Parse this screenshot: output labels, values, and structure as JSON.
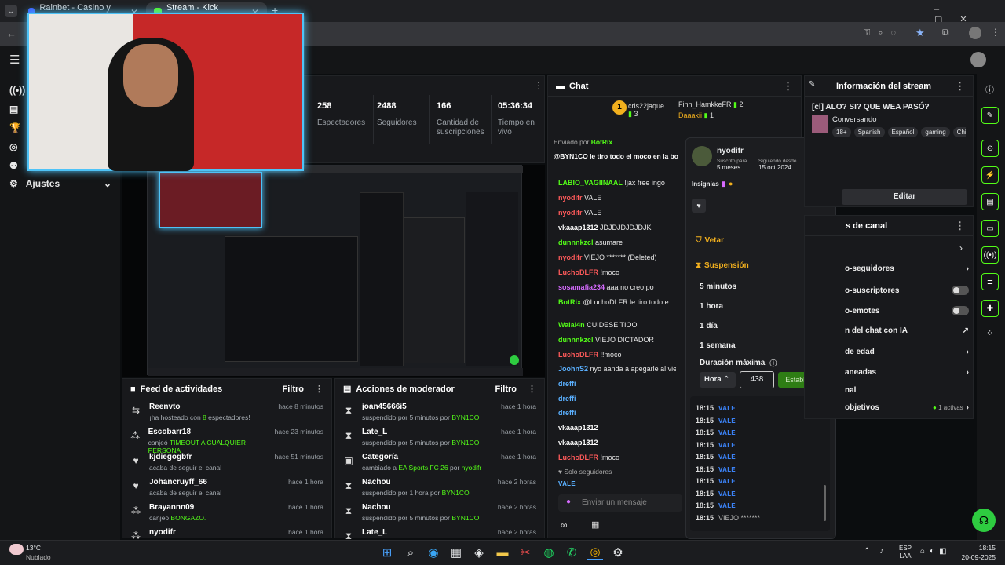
{
  "browser": {
    "tabs": [
      {
        "label": "Rainbet - Casino y Casa de Apu"
      },
      {
        "label": "Stream - Kick Dashboard"
      }
    ]
  },
  "nav": {
    "settings_label": "Ajustes"
  },
  "stats": [
    {
      "value": "258",
      "label": "Espectadores"
    },
    {
      "value": "2488",
      "label": "Seguidores"
    },
    {
      "value": "166",
      "label": "Cantidad de suscripciones"
    },
    {
      "value": "05:36:34",
      "label": "Tiempo en vivo"
    }
  ],
  "feed": {
    "title": "Feed de actividades",
    "filter": "Filtro",
    "rows": [
      {
        "name": "Reenvto",
        "time": "hace 8 minutos",
        "pre": "¡ha hosteado con ",
        "hl": "8",
        "post": " espectadores!"
      },
      {
        "name": "Escobarr18",
        "time": "hace 23 minutos",
        "pre": "canjeó ",
        "hl": "TIMEOUT A CUALQUIER PERSONA",
        "post": ""
      },
      {
        "name": "kjdiegogbfr",
        "time": "hace 51 minutos",
        "pre": "acaba de seguir el canal",
        "hl": "",
        "post": ""
      },
      {
        "name": "Johancruyff_66",
        "time": "hace 1 hora",
        "pre": "acaba de seguir el canal",
        "hl": "",
        "post": ""
      },
      {
        "name": "Brayannn09",
        "time": "hace 1 hora",
        "pre": "canjeó ",
        "hl": "BONGAZO.",
        "post": ""
      },
      {
        "name": "nyodifr",
        "time": "hace 1 hora",
        "pre": "",
        "hl": "",
        "post": ""
      }
    ]
  },
  "mod": {
    "title": "Acciones de moderador",
    "filter": "Filtro",
    "rows": [
      {
        "name": "joan45666i5",
        "time": "hace 1 hora",
        "pre": "suspendido por 5 minutos por ",
        "hl": "BYN1CO"
      },
      {
        "name": "Late_L",
        "time": "hace 1 hora",
        "pre": "suspendido por 5 minutos por ",
        "hl": "BYN1CO"
      },
      {
        "name": "Categoría",
        "time": "hace 1 hora",
        "pre": "cambiado a ",
        "hl": "EA Sports FC 26",
        "post2": " por ",
        "hl2": "nyodifr"
      },
      {
        "name": "Nachou",
        "time": "hace 2 horas",
        "pre": "suspendido por 1 hora por ",
        "hl": "BYN1CO"
      },
      {
        "name": "Nachou",
        "time": "hace 2 horas",
        "pre": "suspendido por 5 minutos por ",
        "hl": "BYN1CO"
      },
      {
        "name": "Late_L",
        "time": "hace 2 horas",
        "pre": "",
        "hl": ""
      }
    ]
  },
  "chat": {
    "title": "Chat",
    "top": [
      {
        "name": "cris22jaque",
        "count": "3"
      },
      {
        "name": "Finn_HamkkeFR",
        "count": "2"
      },
      {
        "name": "Daaakii",
        "count": "1"
      }
    ],
    "pinned_by": "Enviado por",
    "pinned_user": "BotRix",
    "pinned_msg": "@BYN1CO le tiro todo el moco en la bo",
    "lines": [
      {
        "u": "LABIO_VAGIINAAL",
        "c": "#53fc18",
        "m": " !jax free ingo"
      },
      {
        "u": "nyodifr",
        "c": "#ff5a5a",
        "m": " VALE"
      },
      {
        "u": "nyodifr",
        "c": "#ff5a5a",
        "m": " VALE"
      },
      {
        "u": "vkaaap1312",
        "c": "#ffffff",
        "m": " JDJDJDJDJDJK"
      },
      {
        "u": "dunnnkzcl",
        "c": "#53fc18",
        "m": " asumare"
      },
      {
        "u": "nyodifr",
        "c": "#ff5a5a",
        "m": " VIEJO ******* (Deleted)"
      },
      {
        "u": "LuchoDLFR",
        "c": "#ff5a5a",
        "m": " !moco"
      },
      {
        "u": "sosamafia234",
        "c": "#d66bff",
        "m": " aaa no creo po"
      },
      {
        "u": "BotRix",
        "c": "#53fc18",
        "m": " @LuchoDLFR le tiro todo e"
      },
      {
        "u": "",
        "c": "#ffffff",
        "m": ""
      },
      {
        "u": "Walal4n",
        "c": "#53fc18",
        "m": " CUIDESE TIOO"
      },
      {
        "u": "dunnnkzcl",
        "c": "#53fc18",
        "m": " VIEJO DICTADOR"
      },
      {
        "u": "LuchoDLFR",
        "c": "#ff5a5a",
        "m": " !!moco"
      },
      {
        "u": "JoohnS2",
        "c": "#5ab0ff",
        "m": " nyo aanda a apegarle al viejo k"
      },
      {
        "u": "dreffi",
        "c": "#5ab0ff",
        "m": ""
      },
      {
        "u": "dreffi",
        "c": "#5ab0ff",
        "m": ""
      },
      {
        "u": "dreffi",
        "c": "#5ab0ff",
        "m": ""
      },
      {
        "u": "vkaaap1312",
        "c": "#ffffff",
        "m": ""
      },
      {
        "u": "vkaaap1312",
        "c": "#ffffff",
        "m": ""
      },
      {
        "u": "LuchoDLFR",
        "c": "#ff5a5a",
        "m": " !moco"
      }
    ],
    "followers_only": "Solo seguidores",
    "placeholder": "Enviar un mensaje"
  },
  "modal": {
    "user": "nyodifr",
    "sub_label": "Suscrito para",
    "sub_value": "5 meses",
    "follow_label": "Siguiendo desde",
    "follow_value": "15 oct 2024",
    "badges_label": "Insignias",
    "veto": "Vetar",
    "suspension": "Suspensión",
    "options": [
      "5 minutos",
      "1 hora",
      "1 día",
      "1 semana"
    ],
    "max_label": "Duración máxima",
    "unit": "Hora",
    "value": "438",
    "set_button": "Establecer",
    "log": [
      {
        "t": "18:15",
        "m": "VALE"
      },
      {
        "t": "18:15",
        "m": "VALE"
      },
      {
        "t": "18:15",
        "m": "VALE"
      },
      {
        "t": "18:15",
        "m": "VALE"
      },
      {
        "t": "18:15",
        "m": "VALE"
      },
      {
        "t": "18:15",
        "m": "VALE"
      },
      {
        "t": "18:15",
        "m": "VALE"
      },
      {
        "t": "18:15",
        "m": "VALE"
      },
      {
        "t": "18:15",
        "m": "VALE"
      },
      {
        "t": "18:15",
        "m": "VIEJO *******"
      }
    ]
  },
  "info": {
    "title": "Información del stream",
    "stream_title": "[cl] ALO? SI? QUE WEA PASÓ?",
    "category": "Conversando",
    "tags": [
      "18+",
      "Spanish",
      "Español",
      "gaming",
      "Chile"
    ],
    "edit": "Editar"
  },
  "settings": {
    "title": "s de canal",
    "rows": [
      "o-seguidores",
      "o-suscriptores",
      "o-emotes",
      "n del chat con IA",
      "de edad",
      "aneadas",
      "nal",
      "objetivos"
    ],
    "active": "1 activas"
  },
  "taskbar": {
    "temp": "13°C",
    "weather": "Nublado",
    "lang1": "ESP",
    "lang2": "LAA",
    "time": "18:15",
    "date": "20-09-2025"
  }
}
